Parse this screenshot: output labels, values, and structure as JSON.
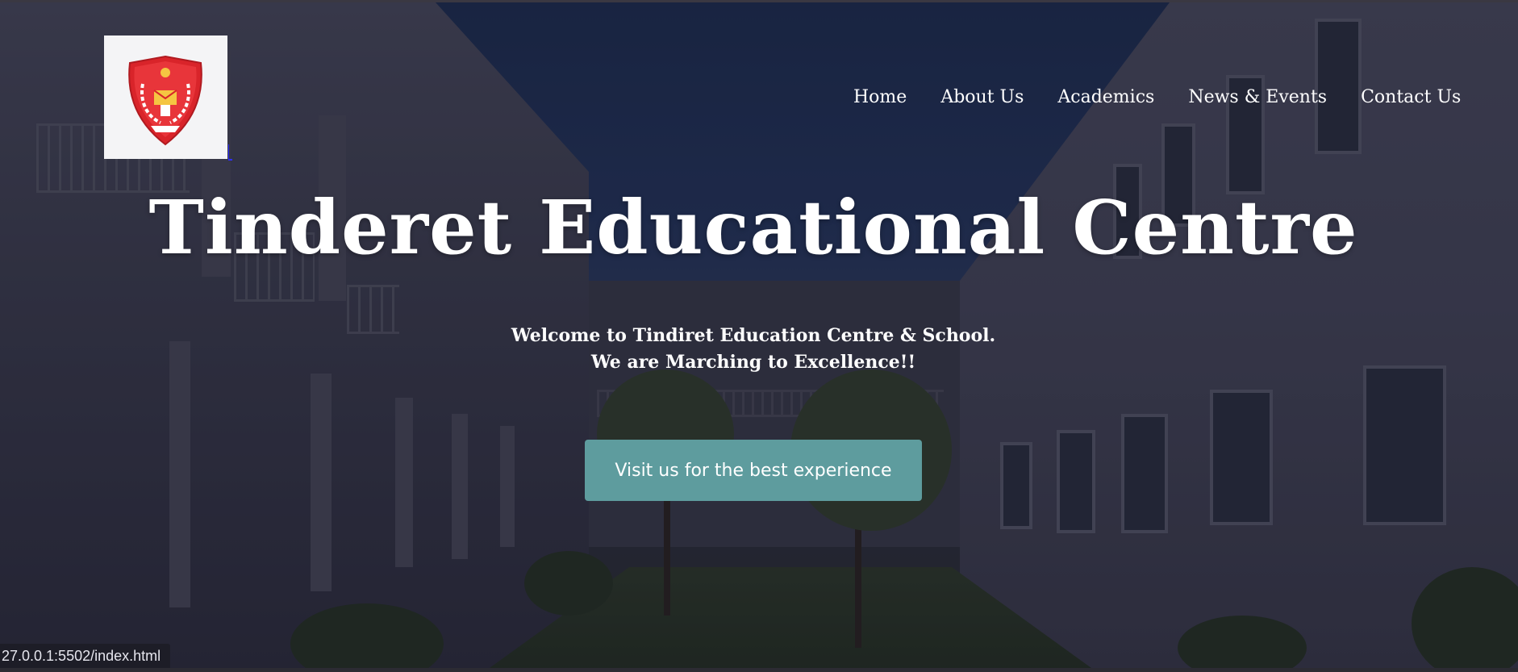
{
  "site": {
    "title": "Tinderet Educational Centre",
    "welcome_line1": "Welcome to Tindiret Education Centre & School.",
    "welcome_line2": "We are Marching to Excellence!!",
    "cta_label": "Visit us for the best experience"
  },
  "nav": {
    "items": [
      {
        "label": "Home"
      },
      {
        "label": "About Us"
      },
      {
        "label": "Academics"
      },
      {
        "label": "News & Events"
      },
      {
        "label": "Contact Us"
      }
    ]
  },
  "logo": {
    "icon": "school-crest-icon",
    "colors": {
      "shield": "#e0242a",
      "wreath": "#ffffff",
      "star": "#f5c542"
    }
  },
  "status_bar": {
    "url": "27.0.0.1:5502/index.html"
  },
  "colors": {
    "cta_background": "#5e9c9e",
    "text": "#ffffff",
    "overlay": "#14142a"
  }
}
